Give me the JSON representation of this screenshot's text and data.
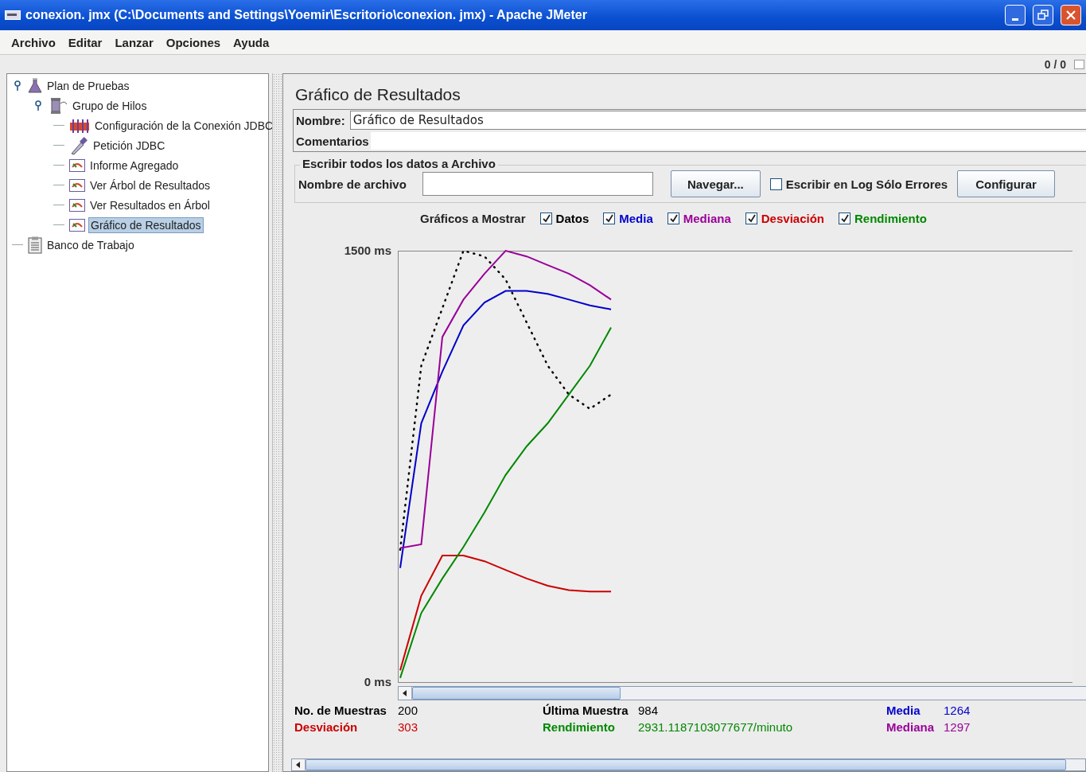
{
  "window": {
    "title": "conexion. jmx (C:\\Documents and Settings\\Yoemir\\Escritorio\\conexion. jmx) - Apache JMeter"
  },
  "menu": [
    "Archivo",
    "Editar",
    "Lanzar",
    "Opciones",
    "Ayuda"
  ],
  "toolbar": {
    "counter": "0 / 0"
  },
  "tree": [
    {
      "label": "Plan de Pruebas",
      "kind": "flask",
      "expanded": true,
      "selected": false,
      "children": [
        {
          "label": "Grupo de Hilos",
          "kind": "spool",
          "expanded": true,
          "selected": false,
          "children": [
            {
              "label": "Configuración de la Conexión JDBC",
              "kind": "config",
              "selected": false
            },
            {
              "label": "Petición JDBC",
              "kind": "dropper",
              "selected": false
            },
            {
              "label": "Informe Agregado",
              "kind": "report",
              "selected": false
            },
            {
              "label": "Ver Árbol de Resultados",
              "kind": "report",
              "selected": false
            },
            {
              "label": "Ver Resultados en Árbol",
              "kind": "report",
              "selected": false
            },
            {
              "label": "Gráfico de Resultados",
              "kind": "report",
              "selected": true
            }
          ]
        }
      ]
    },
    {
      "label": "Banco de Trabajo",
      "kind": "clipboard",
      "selected": false
    }
  ],
  "panel": {
    "title": "Gráfico de Resultados",
    "name_label": "Nombre:",
    "name_value": "Gráfico de Resultados",
    "comments_label": "Comentarios",
    "file_group": {
      "title": "Escribir todos los datos a Archivo",
      "filename_label": "Nombre de archivo",
      "browse_button": "Navegar...",
      "errors_only": {
        "label": "Escribir en Log Sólo Errores",
        "checked": false
      },
      "configure_button": "Configurar"
    },
    "graphs_label": "Gráficos a Mostrar",
    "graphs": [
      {
        "checked": true
      },
      {
        "checked": true
      },
      {
        "checked": true
      },
      {
        "checked": true
      },
      {
        "checked": true
      }
    ],
    "chart_data": {
      "type": "line",
      "ylim": [
        0,
        1500
      ],
      "yticks": [
        {
          "value": 1500,
          "label": "1500 ms"
        },
        {
          "value": 0,
          "label": "0 ms"
        }
      ],
      "series": [
        {
          "name": "Datos",
          "color": "#000000",
          "line_style": "dotted",
          "values": [
            460,
            1100,
            1300,
            1500,
            1480,
            1400,
            1250,
            1100,
            1000,
            950,
            1000
          ]
        },
        {
          "name": "Media",
          "color": "#0000cc",
          "values": [
            397,
            900,
            1080,
            1240,
            1320,
            1360,
            1360,
            1350,
            1330,
            1310,
            1296
          ]
        },
        {
          "name": "Mediana",
          "color": "#990099",
          "values": [
            466,
            479,
            1200,
            1330,
            1420,
            1500,
            1480,
            1450,
            1420,
            1380,
            1330
          ]
        },
        {
          "name": "Desviación",
          "color": "#cc0000",
          "values": [
            41,
            300,
            440,
            440,
            420,
            390,
            360,
            335,
            320,
            315,
            315
          ]
        },
        {
          "name": "Rendimiento",
          "color": "#008800",
          "values": [
            14,
            240,
            360,
            470,
            590,
            720,
            820,
            900,
            1000,
            1100,
            1233
          ]
        }
      ]
    },
    "stats": [
      {
        "label": "No. de Muestras",
        "value": "200",
        "color": "#000000"
      },
      {
        "label": "Última Muestra",
        "value": "984",
        "color": "#000000"
      },
      {
        "label": "Media",
        "value": "1264",
        "color": "#0000cc"
      },
      {
        "label": "Desviación",
        "value": "303",
        "color": "#cc0000"
      },
      {
        "label": "Rendimiento",
        "value": "2931.1187103077677/minuto",
        "color": "#008800"
      },
      {
        "label": "Mediana",
        "value": "1297",
        "color": "#990099"
      }
    ]
  }
}
